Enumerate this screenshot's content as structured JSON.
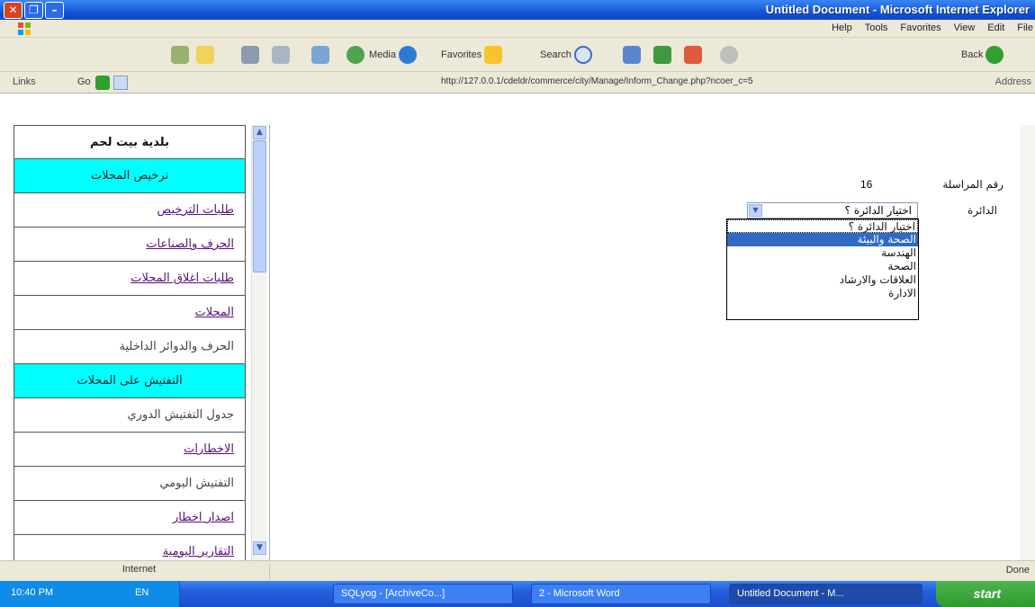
{
  "window": {
    "title": "Untitled Document - Microsoft Internet Explorer"
  },
  "menubar": {
    "items": [
      "File",
      "Edit",
      "View",
      "Favorites",
      "Tools",
      "Help"
    ]
  },
  "toolbar": {
    "back_label": "Back",
    "search_label": "Search",
    "favorites_label": "Favorites",
    "media_label": "Media"
  },
  "addressbar": {
    "address_label": "Address",
    "url": "http://127.0.0.1/cdeldr/commerce/city/Manage/Inform_Change.php?ncoer_c=5",
    "go_label": "Go",
    "links_label": "Links"
  },
  "nav": {
    "items": [
      {
        "label": "بلدية بيت لحم",
        "type": "title"
      },
      {
        "label": "ترخيص المحلات",
        "type": "head"
      },
      {
        "label": "طلبات الترخيص",
        "type": "link"
      },
      {
        "label": "الحرف والصناعات",
        "type": "link"
      },
      {
        "label": "طلبات اغلاق المحلات",
        "type": "link"
      },
      {
        "label": "المحلات",
        "type": "link"
      },
      {
        "label": "الحرف والدوائر الداخلية",
        "type": "plain"
      },
      {
        "label": "التفتيش على المحلات",
        "type": "head"
      },
      {
        "label": "جدول التفتيش الدوري",
        "type": "plain"
      },
      {
        "label": "الاخطارات",
        "type": "link"
      },
      {
        "label": "التفتيش اليومي",
        "type": "plain"
      },
      {
        "label": "اصدار اخطار",
        "type": "link"
      },
      {
        "label": "التقارير اليومية",
        "type": "link"
      }
    ]
  },
  "form": {
    "count_label": "رقم المراسلة",
    "count_value": "16",
    "department_label": "الدائرة",
    "select_value": "اختيار الدائرة ؟",
    "options": [
      "اختيار الدائرة ؟",
      "الصحة والبيئة",
      "الهندسة",
      "الصحة",
      "العلاقات والارشاد",
      "الادارة"
    ],
    "selected_index": 1
  },
  "statusbar": {
    "zone": "Internet",
    "done": "Done"
  },
  "taskbar": {
    "tray_text": "EN",
    "tray_time": "10:40 PM",
    "tasks": [
      "SQLyog - [ArchiveCo...]",
      "2 - Microsoft Word",
      "Untitled Document - M..."
    ],
    "start_label": "start"
  }
}
